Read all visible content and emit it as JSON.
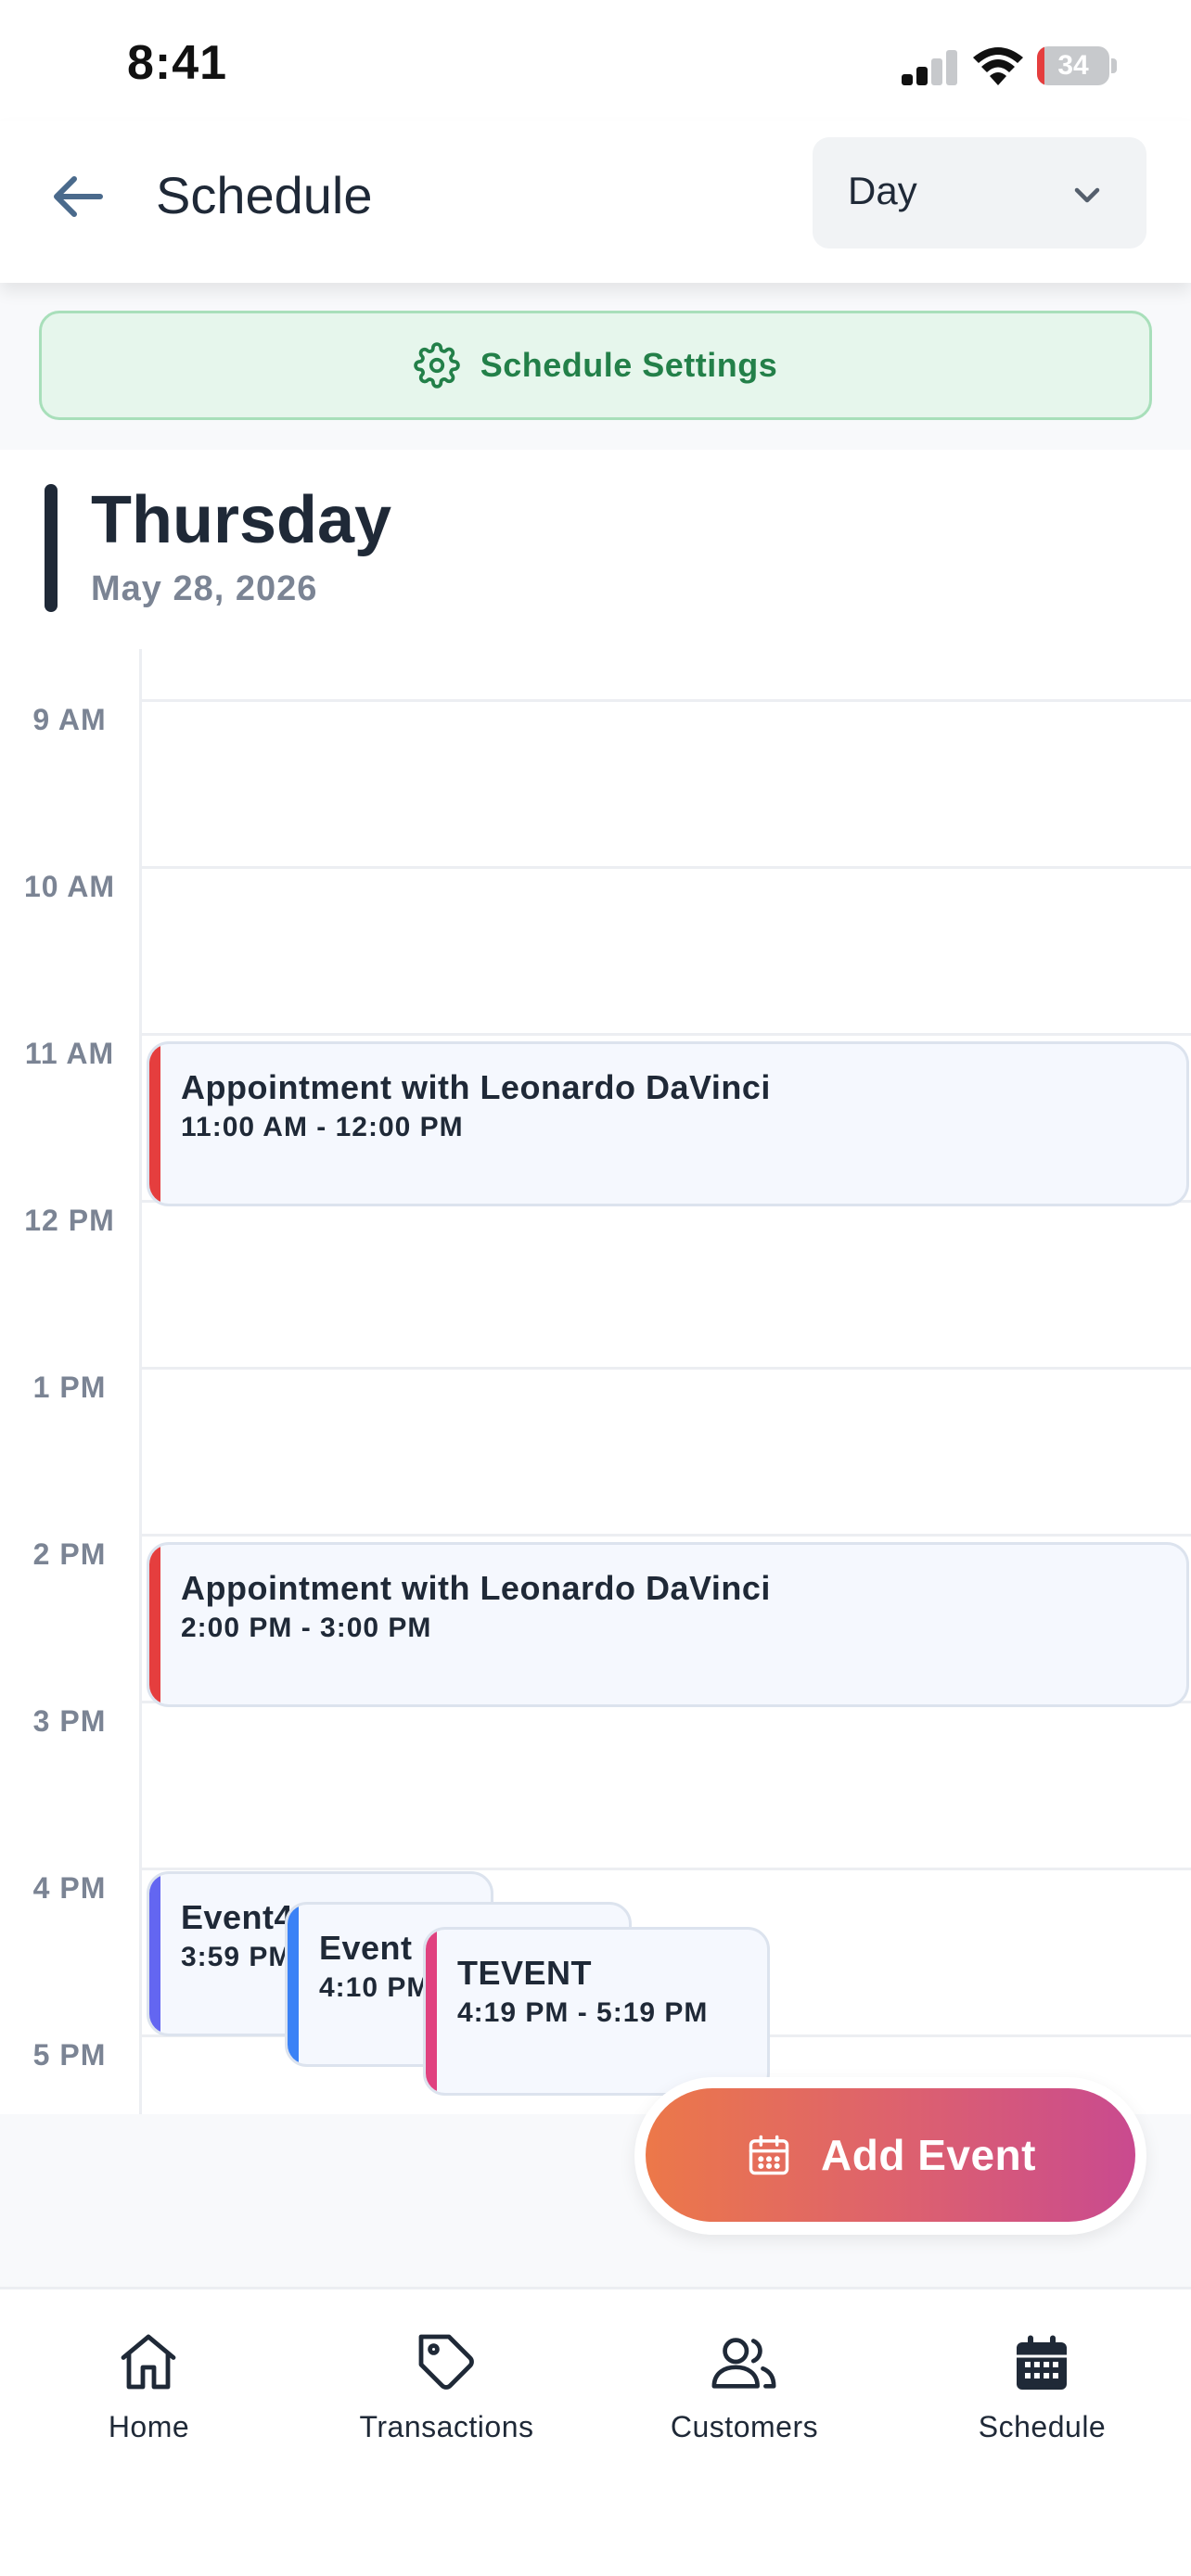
{
  "status_bar": {
    "time": "8:41",
    "battery": "34"
  },
  "header": {
    "title": "Schedule",
    "view_select": {
      "value": "Day"
    }
  },
  "settings": {
    "label": "Schedule Settings"
  },
  "day": {
    "name": "Thursday",
    "date": "May 28, 2026"
  },
  "timeline": {
    "hours": [
      "9 AM",
      "10 AM",
      "11 AM",
      "12 PM",
      "1 PM",
      "2 PM",
      "3 PM",
      "4 PM",
      "5 PM"
    ],
    "events": [
      {
        "title": "Appointment with Leonardo DaVinci",
        "time": "11:00 AM - 12:00 PM",
        "color": "#e53e3e"
      },
      {
        "title": "Appointment with Leonardo DaVinci",
        "time": "2:00 PM - 3:00 PM",
        "color": "#e53e3e"
      },
      {
        "title": "Event4",
        "time": "3:59 PM",
        "color": "#6366f1"
      },
      {
        "title": "Event",
        "time": "4:10 PM",
        "color": "#3b82f6"
      },
      {
        "title": "TEVENT",
        "time": "4:19 PM - 5:19 PM",
        "color": "#e0417f"
      }
    ]
  },
  "add_event": {
    "label": "Add Event"
  },
  "tabs": [
    {
      "label": "Home",
      "icon": "home-icon"
    },
    {
      "label": "Transactions",
      "icon": "tag-icon"
    },
    {
      "label": "Customers",
      "icon": "users-icon"
    },
    {
      "label": "Schedule",
      "icon": "calendar-icon"
    }
  ]
}
